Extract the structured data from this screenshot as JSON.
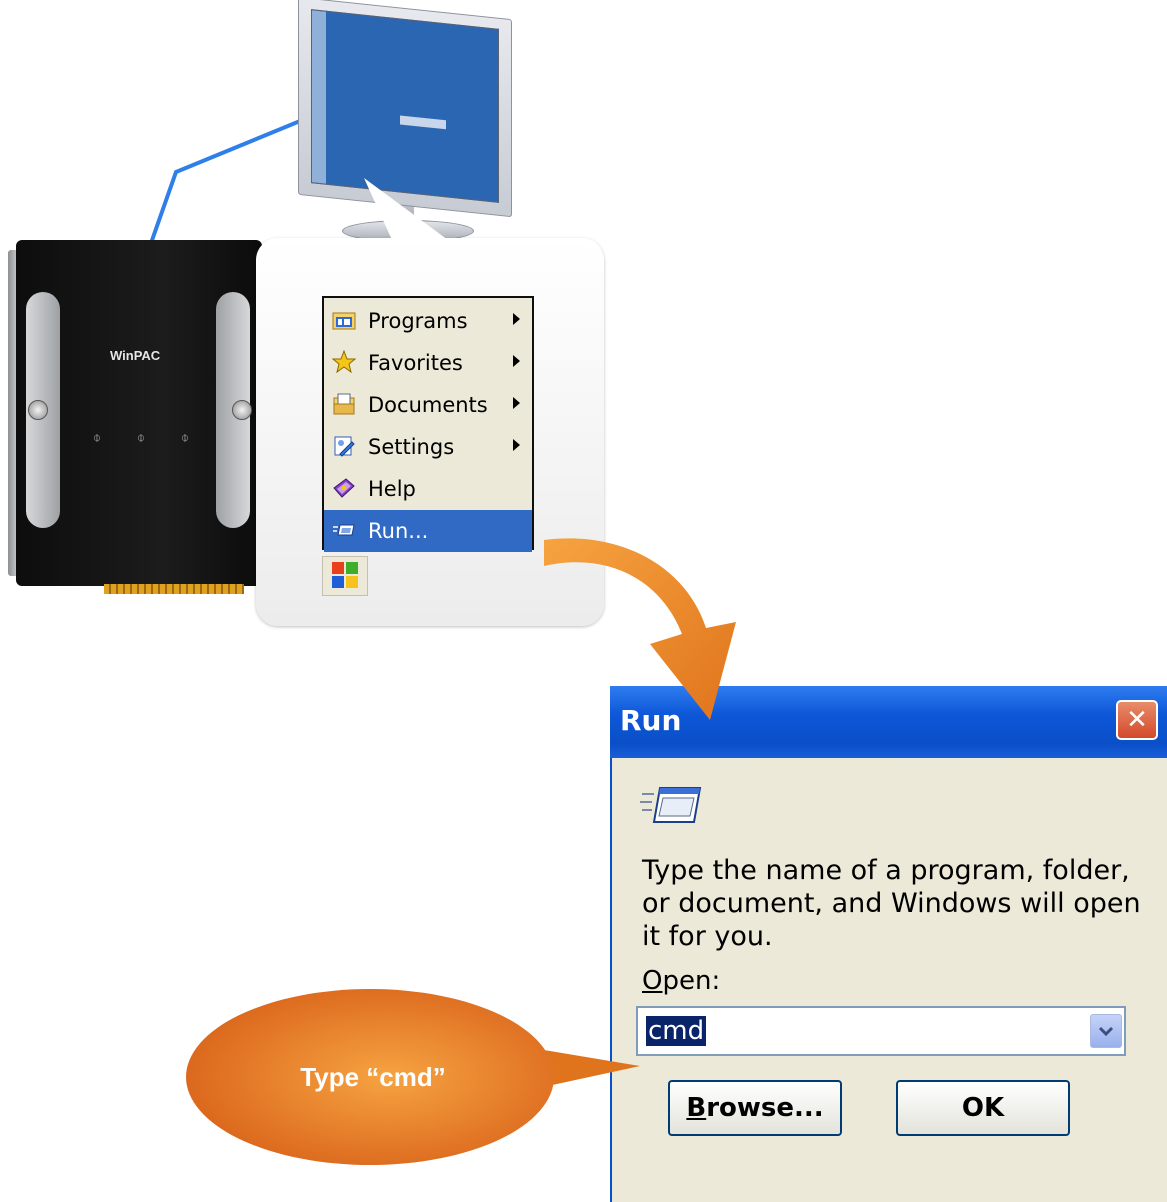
{
  "device": {
    "brand_logo": "WinPAC"
  },
  "start_menu": {
    "items": [
      {
        "label": "Programs",
        "icon": "programs-folder-icon",
        "has_submenu": true,
        "selected": false
      },
      {
        "label": "Favorites",
        "icon": "favorites-star-icon",
        "has_submenu": true,
        "selected": false
      },
      {
        "label": "Documents",
        "icon": "documents-icon",
        "has_submenu": true,
        "selected": false
      },
      {
        "label": "Settings",
        "icon": "settings-icon",
        "has_submenu": true,
        "selected": false
      },
      {
        "label": "Help",
        "icon": "help-book-icon",
        "has_submenu": false,
        "selected": false
      },
      {
        "label": "Run...",
        "icon": "run-icon",
        "has_submenu": false,
        "selected": true
      }
    ],
    "selected_color": "#316ac5",
    "background_color": "#ece9d8"
  },
  "run_dialog": {
    "title": "Run",
    "instruction": "Type the name of a program, folder, or document, and Windows will open it for you.",
    "open_label": "Open:",
    "open_value": "cmd",
    "browse_label": "Browse...",
    "ok_label": "OK",
    "titlebar_color": "#0a4fc8",
    "close_color": "#d3492b"
  },
  "callout": {
    "text": "Type “cmd”",
    "color": "#e0741c"
  },
  "arrow": {
    "color": "#f08a24"
  }
}
